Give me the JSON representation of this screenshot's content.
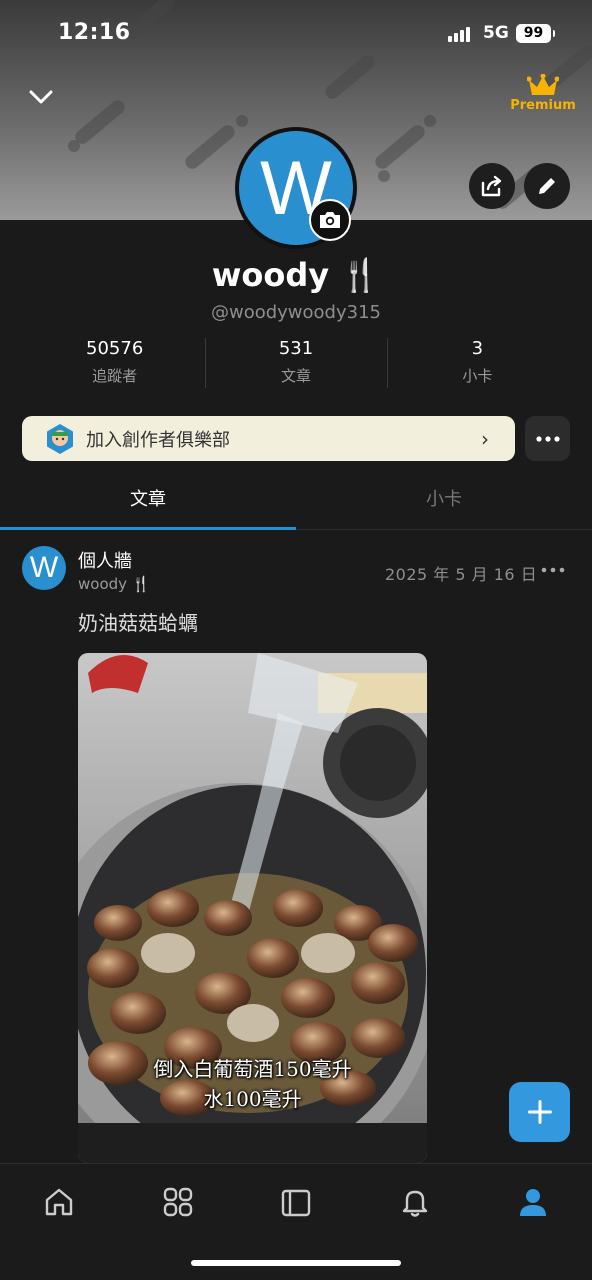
{
  "status_bar": {
    "time": "12:16",
    "network": "5G",
    "battery": "99"
  },
  "header": {
    "premium_label": "Premium"
  },
  "profile": {
    "avatar_letter": "W",
    "name": "woody 🍴",
    "handle": "@woodywoody315",
    "stats": [
      {
        "value": "50576",
        "label": "追蹤者"
      },
      {
        "value": "531",
        "label": "文章"
      },
      {
        "value": "3",
        "label": "小卡"
      }
    ]
  },
  "club_banner": {
    "label": "加入創作者俱樂部",
    "arrow": "›"
  },
  "tabs": [
    {
      "label": "文章",
      "active": true
    },
    {
      "label": "小卡",
      "active": false
    }
  ],
  "post": {
    "avatar_letter": "W",
    "board": "個人牆",
    "author": "woody 🍴",
    "date": "2025 年 5 月 16 日",
    "title": "奶油菇菇蛤蠣",
    "caption_line1": "倒入白葡萄酒150毫升",
    "caption_line2": "水100毫升"
  },
  "colors": {
    "accent": "#2a8fcf",
    "premium": "#f6b400",
    "background": "#1a1a1a",
    "club_bg": "#f2efdc"
  },
  "bottom_nav": [
    {
      "icon": "home-icon"
    },
    {
      "icon": "grid-icon"
    },
    {
      "icon": "cards-icon"
    },
    {
      "icon": "bell-icon"
    },
    {
      "icon": "profile-icon",
      "active": true
    }
  ]
}
